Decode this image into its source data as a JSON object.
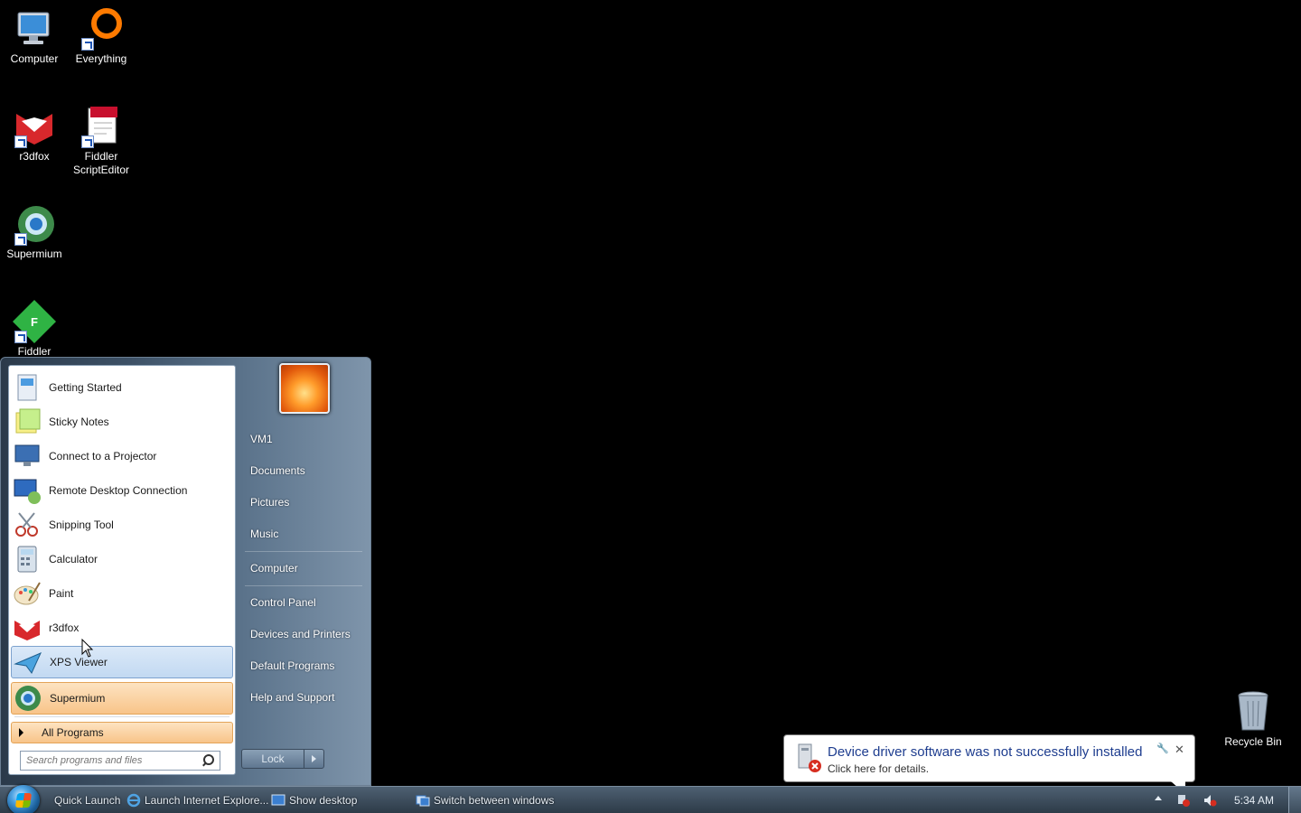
{
  "desktop": {
    "icons": [
      {
        "label": "Computer"
      },
      {
        "label": "Everything"
      },
      {
        "label": "r3dfox"
      },
      {
        "label": "Fiddler\nScriptEditor"
      },
      {
        "label": "Supermium"
      },
      {
        "label": "Fiddler"
      },
      {
        "label": "Recycle Bin"
      }
    ]
  },
  "start_menu": {
    "programs": [
      {
        "label": "Getting Started",
        "icon": "getting-started-icon"
      },
      {
        "label": "Sticky Notes",
        "icon": "sticky-notes-icon"
      },
      {
        "label": "Connect to a Projector",
        "icon": "projector-icon"
      },
      {
        "label": "Remote Desktop Connection",
        "icon": "remote-desktop-icon"
      },
      {
        "label": "Snipping Tool",
        "icon": "scissors-icon"
      },
      {
        "label": "Calculator",
        "icon": "calculator-icon"
      },
      {
        "label": "Paint",
        "icon": "paint-palette-icon"
      },
      {
        "label": "r3dfox",
        "icon": "r3dfox-icon"
      },
      {
        "label": "XPS Viewer",
        "icon": "xps-viewer-icon"
      },
      {
        "label": "Supermium",
        "icon": "supermium-icon"
      }
    ],
    "all_programs": "All Programs",
    "search_placeholder": "Search programs and files",
    "right_links": [
      "VM1",
      "Documents",
      "Pictures",
      "Music",
      "Computer",
      "Control Panel",
      "Devices and Printers",
      "Default Programs",
      "Help and Support"
    ],
    "lock_label": "Lock"
  },
  "taskbar": {
    "quick_launch": "Quick Launch",
    "launch_ie": "Launch Internet Explore...",
    "show_desktop": "Show desktop",
    "switch_windows": "Switch between windows",
    "clock": "5:34 AM"
  },
  "notification": {
    "title": "Device driver software was not successfully installed",
    "body": "Click here for details.",
    "close": "✕",
    "options": "🔧"
  },
  "colors": {
    "desktop_bg": "#000000",
    "balloon_title": "#1e3d8f",
    "pinned_highlight": "#f8c489",
    "hover_highlight": "#c2d9f2"
  }
}
